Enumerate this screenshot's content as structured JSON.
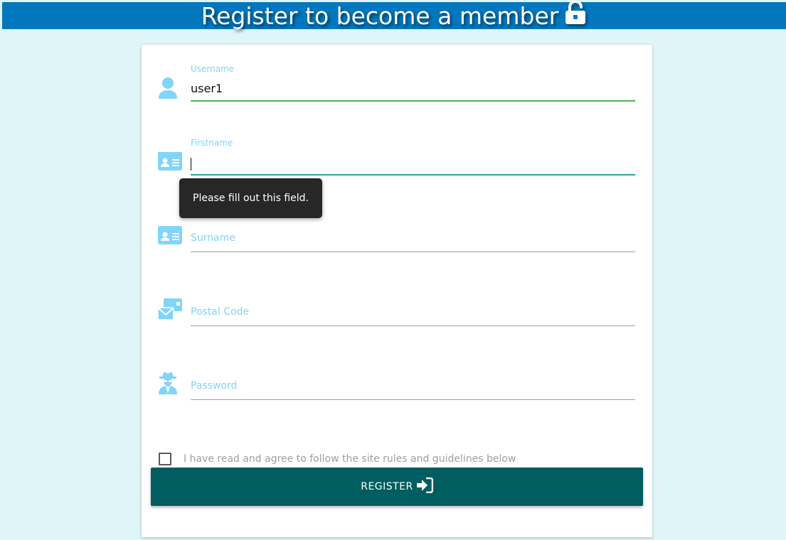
{
  "header": {
    "title": "Register to become a member",
    "icon": "unlock-icon",
    "bg_color": "#0277bd"
  },
  "form": {
    "username": {
      "label": "Username",
      "value": "user1",
      "icon": "user-icon"
    },
    "firstname": {
      "label": "Firstname",
      "value": "",
      "icon": "id-card-icon"
    },
    "surname": {
      "placeholder": "Surname",
      "icon": "id-card-icon"
    },
    "postal_code": {
      "placeholder": "Postal Code",
      "icon": "mail-icon"
    },
    "password": {
      "placeholder": "Password",
      "icon": "user-secret-icon"
    }
  },
  "validation_tooltip": "Please fill out this field.",
  "agree": {
    "label": "I have read and agree to follow the site rules and guidelines below",
    "checked": false
  },
  "register_button": {
    "label": "REGISTER",
    "icon": "sign-in-icon",
    "bg_color": "#005e60"
  },
  "colors": {
    "icon_color": "#81d4fa",
    "focus_color": "#4caf50",
    "page_bg": "#dff6f8"
  }
}
